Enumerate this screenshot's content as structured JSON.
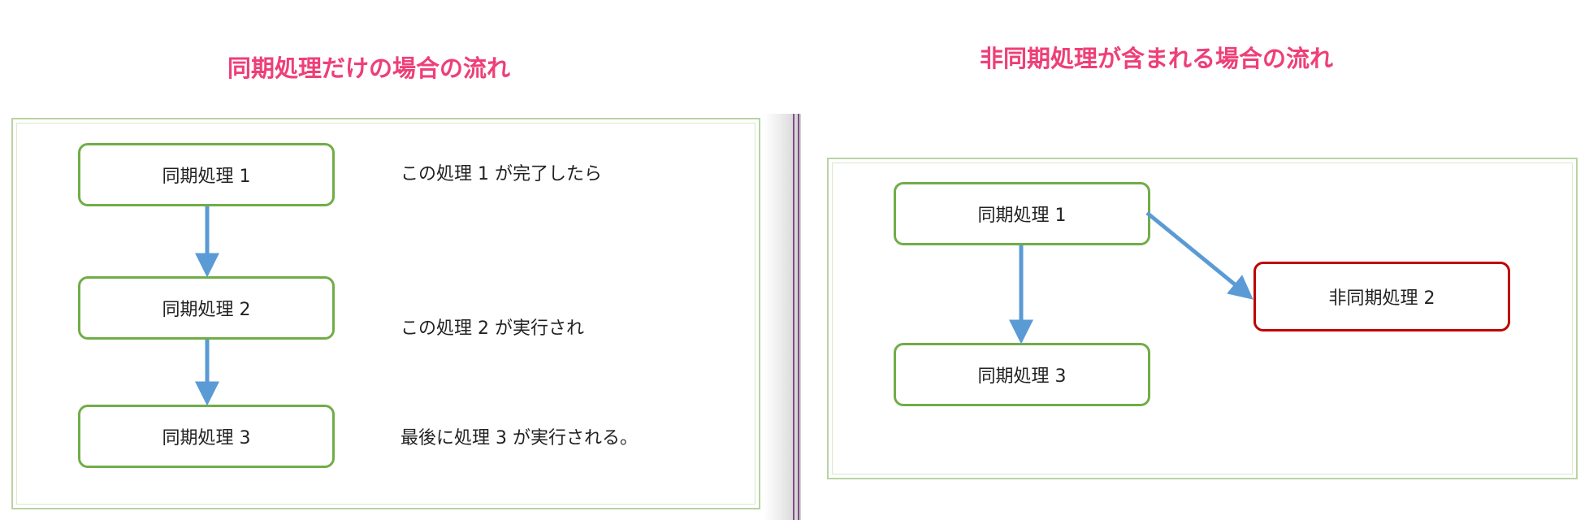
{
  "colors": {
    "title": "#ee3f78",
    "sync_border": "#70ad47",
    "async_border": "#c00000",
    "arrow": "#5b9bd5",
    "separator_line": "#7f4f86"
  },
  "left": {
    "title": "同期処理だけの場合の流れ",
    "boxes": [
      "同期処理 1",
      "同期処理 2",
      "同期処理 3"
    ],
    "notes": [
      "この処理 1 が完了したら",
      "この処理 2 が実行され",
      "最後に処理 3 が実行される。"
    ]
  },
  "right": {
    "title": "非同期処理が含まれる場合の流れ",
    "boxes": [
      "同期処理 1",
      "非同期処理 2",
      "同期処理 3"
    ]
  }
}
